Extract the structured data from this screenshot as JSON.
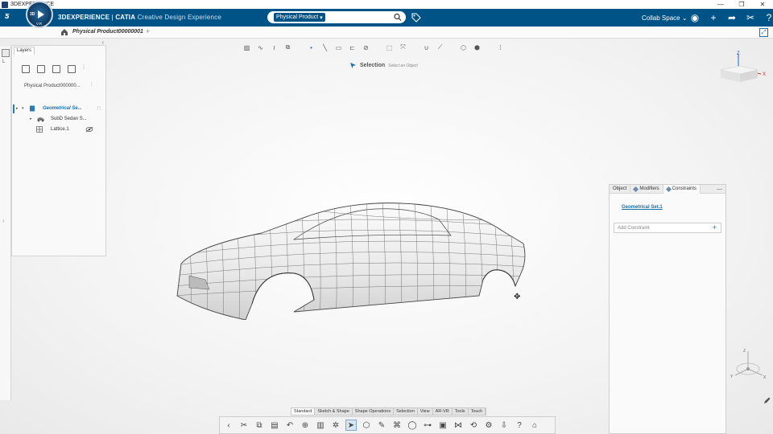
{
  "window": {
    "title": "3DEXPERIENCE",
    "controls": [
      "—",
      "❐",
      "✕"
    ]
  },
  "app": {
    "compass_version": "V.R",
    "brand_main": "3DEXPERIENCE",
    "brand_sep": " | ",
    "brand_app": "CATIA",
    "brand_sub": " Creative Design Experience",
    "search_tag": "Physical Product",
    "search_placeholder": "",
    "collab_space": "Collab Space"
  },
  "tabs": {
    "document": "Physical Product00000001",
    "add": "+"
  },
  "layers": {
    "tab_label": "Layers",
    "product_name": "Physical Product000000...",
    "tree": [
      {
        "label": "Geometrical Se..."
      },
      {
        "label": "SubD Sedan S..."
      },
      {
        "label": "Lattice.1"
      }
    ]
  },
  "left_strip": {
    "label": "L"
  },
  "selection": {
    "title": "Selection",
    "hint": "Select an Object"
  },
  "constraints_panel": {
    "tabs": [
      "Object",
      "Modifiers",
      "Constraints"
    ],
    "active_tab": "Constraints",
    "geometry_link": "Geometrical Set.1",
    "add_constraint_placeholder": "Add Constraint"
  },
  "compass": {
    "z": "Z",
    "x": "X"
  },
  "triad": {
    "z": "Z",
    "x": "X",
    "y": "Y"
  },
  "bottom_tabs": [
    "Standard",
    "Sketch & Shape",
    "Shape Operations",
    "Selection",
    "View",
    "AR-VR",
    "Tools",
    "Touch"
  ],
  "bottom_active": "Standard",
  "colors": {
    "topbar": "#005386",
    "accent": "#1d6fa8",
    "tree_highlight": "#2a7ab5"
  }
}
